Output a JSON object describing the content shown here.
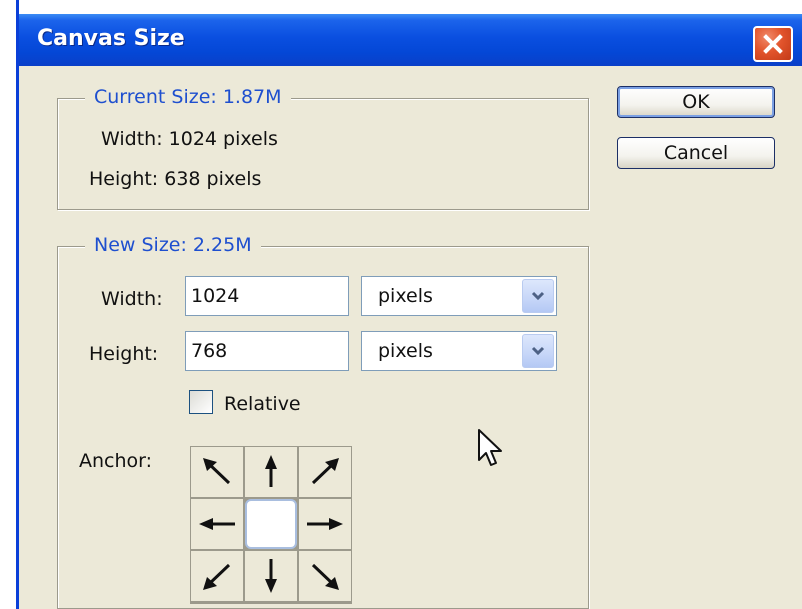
{
  "window": {
    "title": "Canvas Size",
    "close_glyph": "close-x-icon"
  },
  "current_size": {
    "legend": "Current Size:  1.87M",
    "width_text": "Width:  1024 pixels",
    "height_text": "Height:  638 pixels"
  },
  "new_size": {
    "legend": "New Size:  2.25M",
    "width_label": "Width:",
    "width_value": "1024",
    "width_unit": "pixels",
    "height_label": "Height:",
    "height_value": "768",
    "height_unit": "pixels",
    "relative_label": "Relative",
    "relative_checked": false,
    "anchor_label": "Anchor:"
  },
  "buttons": {
    "ok": "OK",
    "cancel": "Cancel"
  },
  "colors": {
    "titlebar": "#0A4FE0",
    "legend_text": "#1E4FCF",
    "dialog_bg": "#ECE9D8",
    "close_button": "#E2542C"
  }
}
